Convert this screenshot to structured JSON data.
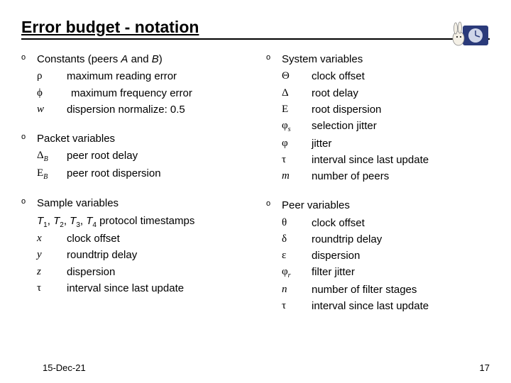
{
  "title": "Error budget - notation",
  "left": {
    "s1": {
      "title_a": "Constants (peers ",
      "title_b": "A",
      "title_c": " and ",
      "title_d": "B",
      "title_e": ")",
      "r1": {
        "sym": "ρ",
        "desc": "maximum reading error"
      },
      "r2": {
        "sym": "ϕ",
        "desc": "maximum frequency error"
      },
      "r3": {
        "sym": "w",
        "desc": "dispersion normalize: 0.5"
      }
    },
    "s2": {
      "title": "Packet variables",
      "r1": {
        "sym": "Δ",
        "sub": "B",
        "desc": "peer root delay"
      },
      "r2": {
        "sym": "Ε",
        "sub": "B",
        "desc": "peer root dispersion"
      }
    },
    "s3": {
      "title": "Sample variables",
      "r1": {
        "sym_a": "T",
        "sub_a": "1",
        "mid_a": ", ",
        "sym_b": "T",
        "sub_b": "2",
        "mid_b": ", ",
        "sym_c": "T",
        "sub_c": "3",
        "mid_c": ", ",
        "sym_d": "T",
        "sub_d": "4",
        "desc": " protocol timestamps"
      },
      "r2": {
        "sym": "x",
        "desc": "clock offset"
      },
      "r3": {
        "sym": "y",
        "desc": "roundtrip delay"
      },
      "r4": {
        "sym": "z",
        "desc": "dispersion"
      },
      "r5": {
        "sym": "τ",
        "desc": "interval since last update"
      }
    }
  },
  "right": {
    "s1": {
      "title": "System variables",
      "r1": {
        "sym": "Θ",
        "desc": "clock offset"
      },
      "r2": {
        "sym": "Δ",
        "desc": "root delay"
      },
      "r3": {
        "sym": "Ε",
        "desc": "root dispersion"
      },
      "r4": {
        "sym": "φ",
        "sub": "s",
        "desc": "selection jitter"
      },
      "r5": {
        "sym": "φ",
        "desc": "jitter"
      },
      "r6": {
        "sym": "τ",
        "desc": "interval since last update"
      },
      "r7": {
        "sym": "m",
        "desc": "number of peers"
      }
    },
    "s2": {
      "title": "Peer variables",
      "r1": {
        "sym": "θ",
        "desc": "clock offset"
      },
      "r2": {
        "sym": "δ",
        "desc": "roundtrip delay"
      },
      "r3": {
        "sym": "ε",
        "desc": "dispersion"
      },
      "r4": {
        "sym": "φ",
        "sub": "r",
        "desc": "filter jitter"
      },
      "r5": {
        "sym": "n",
        "desc": "number of filter stages"
      },
      "r6": {
        "sym": "τ",
        "desc": "interval since last update"
      }
    }
  },
  "footer": {
    "date": "15-Dec-21",
    "page": "17"
  },
  "bullet_char": "o"
}
